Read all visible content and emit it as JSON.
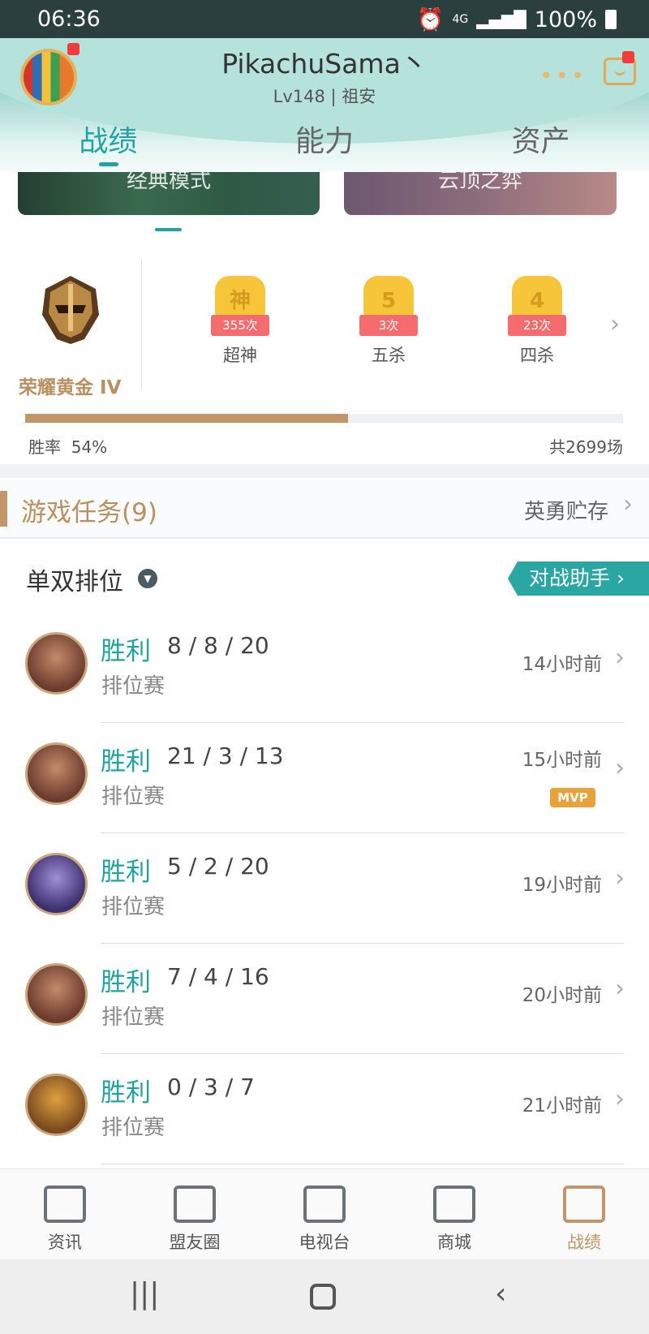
{
  "status_bar": {
    "time": "06:36",
    "network": "4G",
    "battery": "100%"
  },
  "header": {
    "username": "PikachuSama丶",
    "level": "Lv148 | 祖安",
    "more": "•••"
  },
  "tabs": [
    {
      "label": "战绩",
      "active": true
    },
    {
      "label": "能力",
      "active": false
    },
    {
      "label": "资产",
      "active": false
    }
  ],
  "modes": [
    {
      "label": "经典模式"
    },
    {
      "label": "云顶之弈"
    }
  ],
  "rank": {
    "name": "荣耀黄金 IV"
  },
  "honors": [
    {
      "badge": "神",
      "count": "355次",
      "label": "超神"
    },
    {
      "badge": "5",
      "count": "3次",
      "label": "五杀"
    },
    {
      "badge": "4",
      "count": "23次",
      "label": "四杀"
    }
  ],
  "stats": {
    "win_rate_label": "胜率",
    "win_rate_value": "54%",
    "win_rate_fraction": 0.54,
    "total_games": "共2699场"
  },
  "tasks": {
    "title": "游戏任务(9)",
    "link": "英勇贮存"
  },
  "queue": {
    "title": "单双排位",
    "assist_button": "对战助手 ›"
  },
  "matches": [
    {
      "result": "胜利",
      "kda": "8 / 8 / 20",
      "mode": "排位赛",
      "time": "14小时前",
      "mvp": false,
      "avatar_color": "#6b3b2e"
    },
    {
      "result": "胜利",
      "kda": "21 / 3 / 13",
      "mode": "排位赛",
      "time": "15小时前",
      "mvp": true,
      "mvp_label": "MVP",
      "avatar_color": "#6b3b2e"
    },
    {
      "result": "胜利",
      "kda": "5 / 2 / 20",
      "mode": "排位赛",
      "time": "19小时前",
      "mvp": false,
      "avatar_color": "#3b2f6e"
    },
    {
      "result": "胜利",
      "kda": "7 / 4 / 16",
      "mode": "排位赛",
      "time": "20小时前",
      "mvp": false,
      "avatar_color": "#6b3b2e"
    },
    {
      "result": "胜利",
      "kda": "0 / 3 / 7",
      "mode": "排位赛",
      "time": "21小时前",
      "mvp": false,
      "avatar_color": "#7a4a1e"
    }
  ],
  "bottom_nav": [
    {
      "label": "资讯",
      "icon": "book-icon",
      "active": false
    },
    {
      "label": "盟友圈",
      "icon": "chat-heart-icon",
      "active": false
    },
    {
      "label": "电视台",
      "icon": "tv-icon",
      "active": false
    },
    {
      "label": "商城",
      "icon": "shop-icon",
      "active": false
    },
    {
      "label": "战绩",
      "icon": "shield-icon",
      "active": true
    }
  ],
  "colors": {
    "accent": "#22a3a3",
    "gold": "#c2956a",
    "header_bg": "#8fcfc5"
  }
}
